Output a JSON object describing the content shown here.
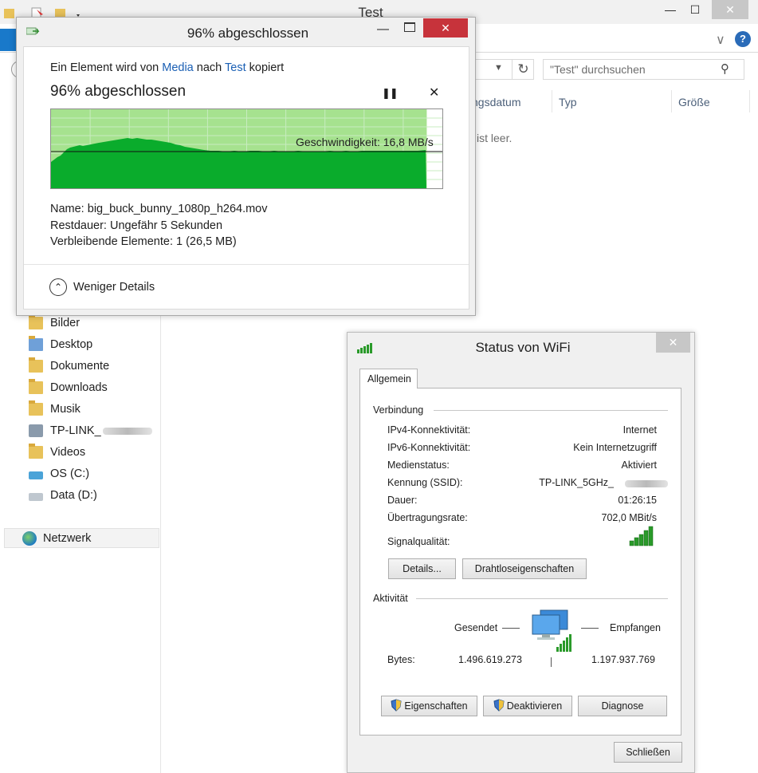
{
  "explorer": {
    "title": "Test",
    "search_placeholder": "\"Test\" durchsuchen",
    "columns": [
      "ngsdatum",
      "Typ",
      "Größe"
    ],
    "empty_text": "ist leer.",
    "nav_items": [
      {
        "label": "Bilder",
        "icon": "pictures-folder-icon"
      },
      {
        "label": "Desktop",
        "icon": "desktop-folder-icon"
      },
      {
        "label": "Dokumente",
        "icon": "documents-folder-icon"
      },
      {
        "label": "Downloads",
        "icon": "downloads-folder-icon"
      },
      {
        "label": "Musik",
        "icon": "music-folder-icon"
      },
      {
        "label": "TP-LINK_",
        "icon": "network-drive-icon"
      },
      {
        "label": "Videos",
        "icon": "videos-folder-icon"
      },
      {
        "label": "OS (C:)",
        "icon": "system-drive-icon"
      },
      {
        "label": "Data (D:)",
        "icon": "drive-icon"
      }
    ],
    "network_label": "Netzwerk"
  },
  "copy_dialog": {
    "title": "96% abgeschlossen",
    "line_prefix": "Ein Element wird von",
    "source": "Media",
    "line_mid": "nach",
    "destination": "Test",
    "line_suffix": "kopiert",
    "heading": "96% abgeschlossen",
    "progress_percent": 96,
    "speed_label": "Geschwindigkeit: 16,8 MB/s",
    "name_label": "Name:",
    "name_value": "big_buck_bunny_1080p_h264.mov",
    "remaining_time_label": "Restdauer:",
    "remaining_time_value": "Ungefähr 5 Sekunden",
    "remaining_items_label": "Verbleibende Elemente:",
    "remaining_items_value": "1 (26,5 MB)",
    "less_details_label": "Weniger Details",
    "colors": {
      "progress_fill": "#a6e28f",
      "speed_fill": "#0aac2c",
      "close": "#c7333b"
    }
  },
  "wifi_dialog": {
    "title": "Status von WiFi",
    "tab_label": "Allgemein",
    "connection_title": "Verbindung",
    "rows": [
      {
        "label": "IPv4-Konnektivität:",
        "value": "Internet"
      },
      {
        "label": "IPv6-Konnektivität:",
        "value": "Kein Internetzugriff"
      },
      {
        "label": "Medienstatus:",
        "value": "Aktiviert"
      },
      {
        "label": "Kennung (SSID):",
        "value": "TP-LINK_5GHz_"
      },
      {
        "label": "Dauer:",
        "value": "01:26:15"
      },
      {
        "label": "Übertragungsrate:",
        "value": "702,0 MBit/s"
      }
    ],
    "signal_label": "Signalqualität:",
    "details_button": "Details...",
    "wireless_props_button": "Drahtloseigenschaften",
    "activity_title": "Aktivität",
    "sent_label": "Gesendet",
    "received_label": "Empfangen",
    "bytes_label": "Bytes:",
    "bytes_sent": "1.496.619.273",
    "bytes_received": "1.197.937.769",
    "properties_button": "Eigenschaften",
    "disable_button": "Deaktivieren",
    "diagnose_button": "Diagnose",
    "close_button": "Schließen"
  }
}
